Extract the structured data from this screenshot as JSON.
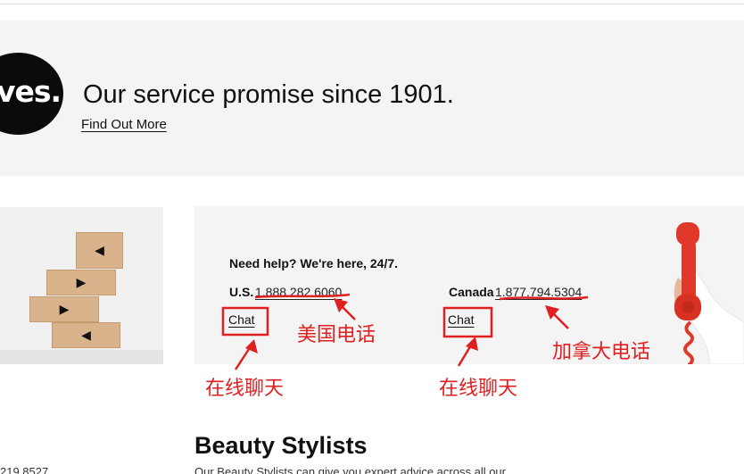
{
  "promo": {
    "logo_fragment": "ves.",
    "title": "Our service promise since 1901.",
    "find_more_label": "Find Out More"
  },
  "boxes_art": {
    "icon": "shipping-boxes-illustration",
    "arrows": [
      "◀",
      "▶",
      "◀",
      "▶",
      "◀"
    ]
  },
  "help": {
    "heading": "Need help? We're here, 24/7.",
    "us_label": "U.S.",
    "us_phone": "1.888.282.6060",
    "canada_label": "Canada",
    "canada_phone": "1.877.794.5304",
    "chat_us_label": "Chat",
    "chat_canada_label": "Chat",
    "image_icon": "red-telephone-handset"
  },
  "annotations": {
    "us_phone_note": "美国电话",
    "canada_phone_note": "加拿大电话",
    "chat_us_note": "在线聊天",
    "chat_canada_note": "在线聊天",
    "color": "#e02020"
  },
  "beauty": {
    "title": "Beauty Stylists",
    "desc": "Our Beauty Stylists can give you expert advice across all our"
  },
  "left_partial_text": "219.8527",
  "colors": {
    "band_bg": "#f4f4f4",
    "annotation_red": "#e02020",
    "handset_red": "#e0392b"
  }
}
